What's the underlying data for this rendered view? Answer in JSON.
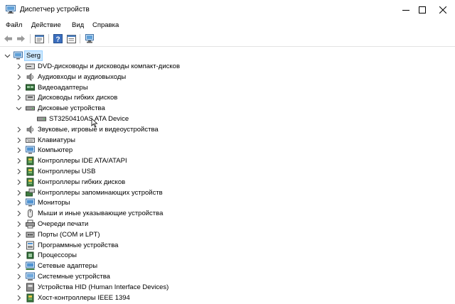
{
  "window": {
    "title": "Диспетчер устройств",
    "icon": "device-manager-icon"
  },
  "menu": [
    "Файл",
    "Действие",
    "Вид",
    "Справка"
  ],
  "toolbar": {
    "buttons": [
      "back-arrow-icon",
      "forward-arrow-icon",
      "properties-icon",
      "help-icon",
      "update-driver-icon"
    ]
  },
  "tree": {
    "root": "Serg",
    "categories": [
      {
        "label": "DVD-дисководы и дисководы компакт-дисков",
        "icon": "dvd-drive-icon",
        "expanded": false
      },
      {
        "label": "Аудиовходы и аудиовыходы",
        "icon": "speaker-icon",
        "expanded": false
      },
      {
        "label": "Видеоадаптеры",
        "icon": "display-adapter-icon",
        "expanded": false
      },
      {
        "label": "Дисководы гибких дисков",
        "icon": "floppy-drive-icon",
        "expanded": false
      },
      {
        "label": "Дисковые устройства",
        "icon": "disk-drive-icon",
        "expanded": true,
        "children": [
          {
            "label": "ST3250410AS ATA Device",
            "icon": "disk-drive-icon"
          }
        ]
      },
      {
        "label": "Звуковые, игровые и видеоустройства",
        "icon": "speaker-icon",
        "expanded": false
      },
      {
        "label": "Клавиатуры",
        "icon": "keyboard-icon",
        "expanded": false
      },
      {
        "label": "Компьютер",
        "icon": "monitor-icon",
        "expanded": false
      },
      {
        "label": "Контроллеры IDE ATA/ATAPI",
        "icon": "ide-controller-icon",
        "expanded": false
      },
      {
        "label": "Контроллеры USB",
        "icon": "usb-controller-icon",
        "expanded": false
      },
      {
        "label": "Контроллеры гибких дисков",
        "icon": "floppy-controller-icon",
        "expanded": false
      },
      {
        "label": "Контроллеры запоминающих устройств",
        "icon": "storage-controller-icon",
        "expanded": false
      },
      {
        "label": "Мониторы",
        "icon": "monitor-icon",
        "expanded": false
      },
      {
        "label": "Мыши и иные указывающие устройства",
        "icon": "mouse-icon",
        "expanded": false
      },
      {
        "label": "Очереди печати",
        "icon": "printer-icon",
        "expanded": false
      },
      {
        "label": "Порты (COM и LPT)",
        "icon": "port-icon",
        "expanded": false
      },
      {
        "label": "Программные устройства",
        "icon": "software-device-icon",
        "expanded": false
      },
      {
        "label": "Процессоры",
        "icon": "processor-icon",
        "expanded": false
      },
      {
        "label": "Сетевые адаптеры",
        "icon": "network-adapter-icon",
        "expanded": false
      },
      {
        "label": "Системные устройства",
        "icon": "system-device-icon",
        "expanded": false
      },
      {
        "label": "Устройства HID (Human Interface Devices)",
        "icon": "hid-device-icon",
        "expanded": false
      },
      {
        "label": "Хост-контроллеры IEEE 1394",
        "icon": "ieee1394-controller-icon",
        "expanded": false
      }
    ]
  }
}
